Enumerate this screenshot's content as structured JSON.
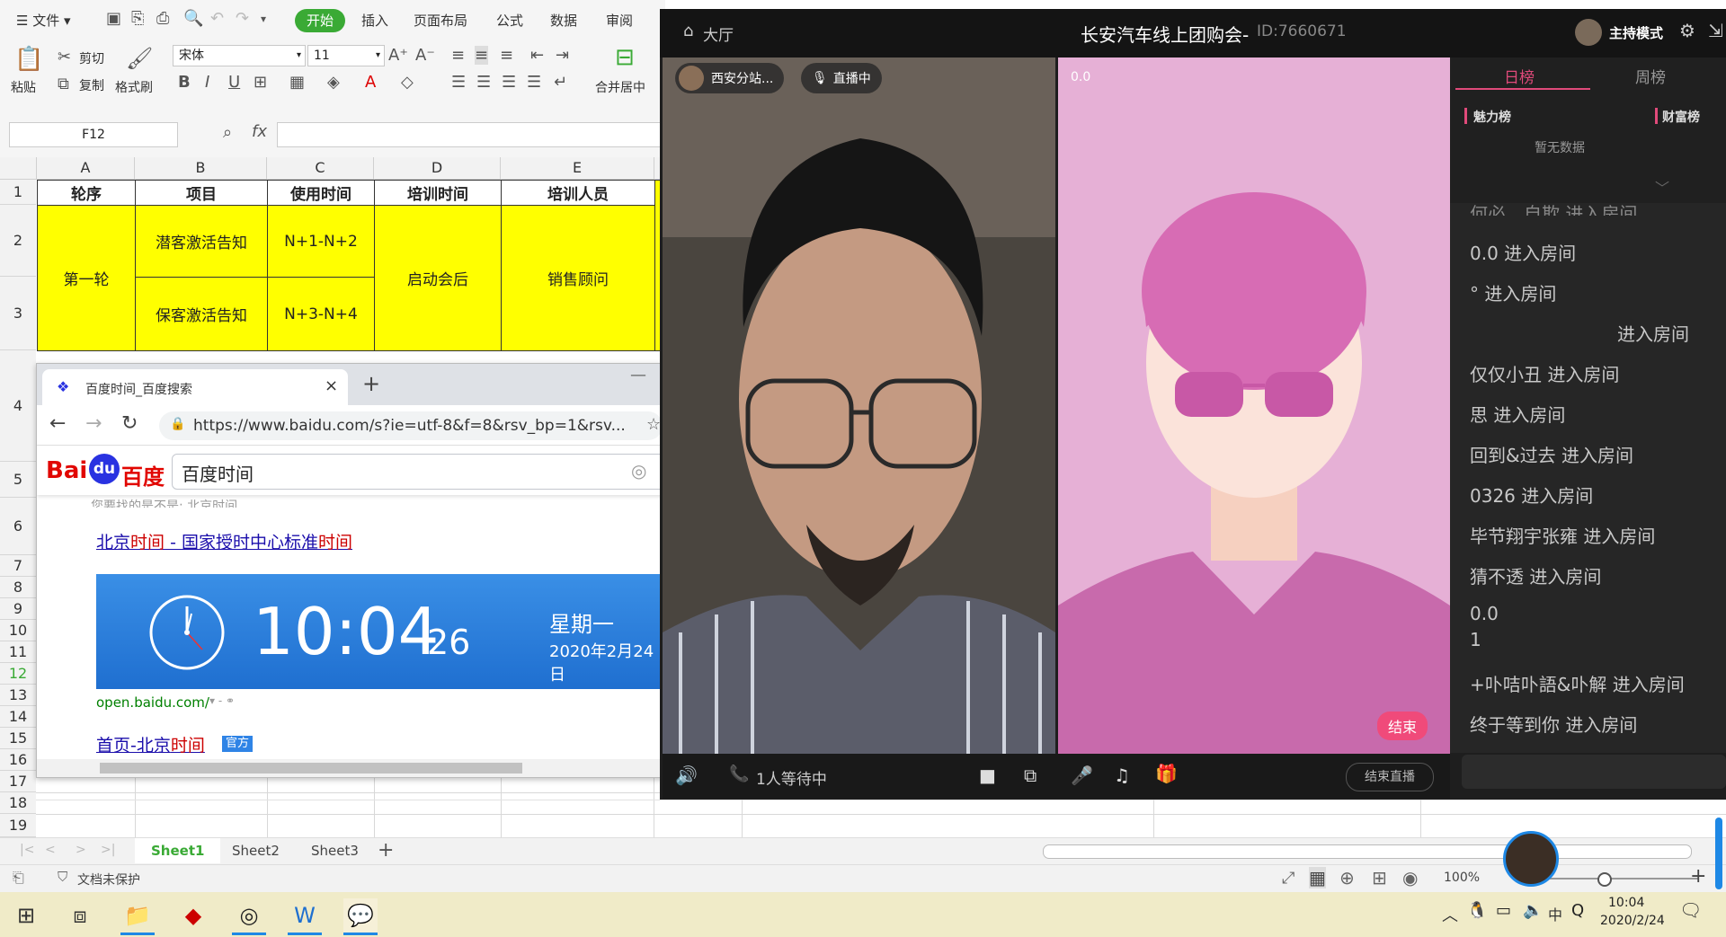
{
  "wps": {
    "menu_label": "文件",
    "tabs": [
      "开始",
      "插入",
      "页面布局",
      "公式",
      "数据",
      "审阅"
    ],
    "ribbon": {
      "paste": "粘贴",
      "cut": "剪切",
      "copy": "复制",
      "format_painter": "格式刷",
      "font_name": "宋体",
      "font_size": "11",
      "bold": "B",
      "italic": "I",
      "underline": "U",
      "merge_center": "合并居中"
    },
    "name_box": "F12",
    "fx_label": "fx",
    "columns": [
      "A",
      "B",
      "C",
      "D",
      "E"
    ],
    "rows": [
      "1",
      "2",
      "3",
      "4",
      "5",
      "6",
      "7",
      "8",
      "9",
      "10",
      "11",
      "12",
      "13",
      "14",
      "15",
      "16",
      "17",
      "18",
      "19"
    ],
    "table": {
      "headers": [
        "轮序",
        "项目",
        "使用时间",
        "培训时间",
        "培训人员"
      ],
      "round": "第一轮",
      "items": [
        "潜客激活告知",
        "保客激活告知"
      ],
      "times": [
        "N+1-N+2",
        "N+3-N+4"
      ],
      "training_time": "启动会后",
      "trainer": "销售顾问"
    },
    "sheets": [
      "Sheet1",
      "Sheet2",
      "Sheet3"
    ],
    "add_sheet": "+",
    "status_protect": "文档未保护",
    "zoom": "100%"
  },
  "browser": {
    "tab_title": "百度时间_百度搜索",
    "url": "https://www.baidu.com/s?ie=utf-8&f=8&rsv_bp=1&rsv...",
    "logo_text": "Bai",
    "logo_du": "du",
    "logo_cn": "百度",
    "query": "百度时间",
    "result1_parts": [
      "北京",
      "时间",
      " - 国家授时中心标准",
      "时间"
    ],
    "clock_time": "10:04",
    "clock_seconds": "26",
    "clock_weekday": "星期一",
    "clock_date": "2020年2月24日",
    "result1_url": "open.baidu.com/",
    "result2_parts": [
      "首页-北京",
      "时间"
    ],
    "result2_badge": "官方",
    "hidden_hint": "您要找的是不是: 北京时间"
  },
  "live": {
    "hall": "大厅",
    "title": "长安汽车线上团购会-",
    "room_id": "ID:7660671",
    "host_mode": "主持模式",
    "host_name": "西安分站...",
    "live_badge": "直播中",
    "right_score": "0.0",
    "end_small": "结束",
    "waiting": "1人等待中",
    "end_live": "结束直播",
    "rank_tabs": [
      "日榜",
      "周榜"
    ],
    "charm": "魅力榜",
    "wealth": "财富榜",
    "no_data": "暂无数据",
    "chat": [
      "何必、自欺 进入房间",
      "0.0 进入房间",
      "° 进入房间",
      "进入房间",
      "仅仅小丑 进入房间",
      "思 进入房间",
      "回到&过去 进入房间",
      "0326 进入房间",
      "毕节翔宇张雍 进入房间",
      "猜不透 进入房间",
      "0.0",
      "1",
      "+卟咭卟語&卟解 进入房间",
      "终于等到你 进入房间"
    ]
  },
  "taskbar": {
    "time": "10:04",
    "date": "2020/2/24",
    "ime": "中"
  }
}
